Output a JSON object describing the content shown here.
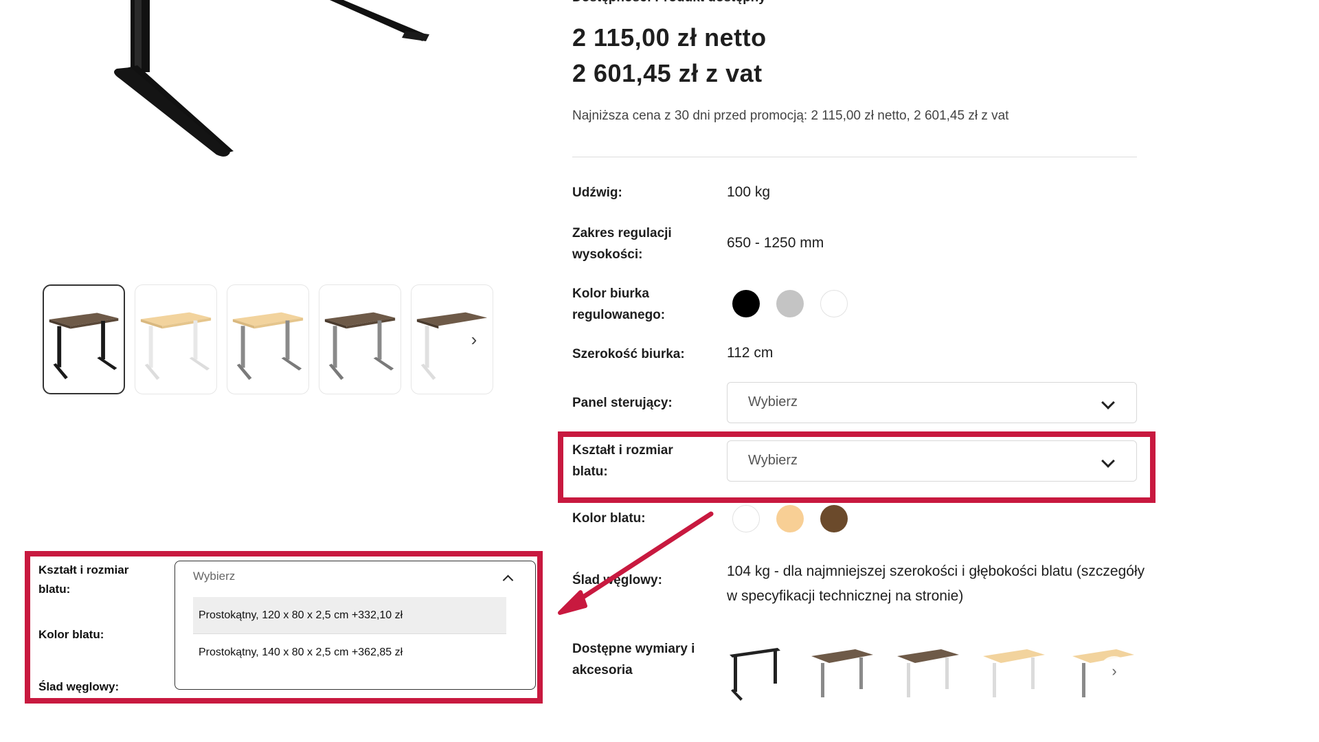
{
  "product": {
    "availability": "Dostępność: Produkt dostępny",
    "price_net": "2 115,00 zł netto",
    "price_vat": "2 601,45 zł z vat",
    "lowest_price": "Najniższa cena z 30 dni przed promocją: 2 115,00 zł netto, 2 601,45 zł z vat"
  },
  "gallery": {
    "thumbnails": [
      {
        "name": "walnut-top-black-frame"
      },
      {
        "name": "maple-top-white-frame"
      },
      {
        "name": "maple-top-grey-frame"
      },
      {
        "name": "walnut-top-grey-frame"
      },
      {
        "name": "walnut-top-white-frame"
      }
    ],
    "next_icon": "chevron-right-icon"
  },
  "attributes": {
    "capacity_label": "Udźwig:",
    "capacity_value": "100 kg",
    "height_range_label": "Zakres regulacji wysokości:",
    "height_range_value": "650 - 1250 mm",
    "frame_color_label": "Kolor biurka regulowanego:",
    "frame_colors": [
      "#000000",
      "#c4c4c4",
      "#ffffff"
    ],
    "width_label": "Szerokość biurka:",
    "width_value": "112 cm",
    "panel_label": "Panel sterujący:",
    "panel_value": "Wybierz",
    "shape_label": "Kształt i rozmiar blatu:",
    "shape_value": "Wybierz",
    "top_color_label": "Kolor blatu:",
    "top_colors": [
      "#ffffff",
      "#f8cf95",
      "#6b4a2b"
    ],
    "carbon_label": "Ślad węglowy:",
    "carbon_value": "104 kg - dla najmniejszej szerokości i głębokości blatu (szczegóły w specyfikacji technicznej na stronie)",
    "accessories_label": "Dostępne wymiary i akcesoria"
  },
  "inset": {
    "shape_label": "Kształt i rozmiar blatu:",
    "top_color_label": "Kolor blatu:",
    "carbon_label": "Ślad węglowy:",
    "select_value": "Wybierz",
    "options": [
      "Prostokątny, 120 x 80 x 2,5 cm +332,10 zł",
      "Prostokątny, 140 x 80 x 2,5 cm +362,85 zł"
    ]
  },
  "colors": {
    "highlight": "#c8193f",
    "cta_green": "#33cc33"
  }
}
